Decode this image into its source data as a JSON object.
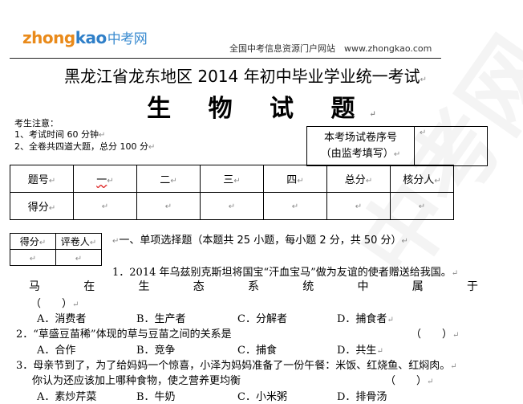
{
  "header": {
    "logo_zhong": "zhong",
    "logo_kao": "kao",
    "logo_cn": "中考网",
    "tagline": "全国中考信息资源门户网站　www.zhongkao.com",
    "watermark": "中考网"
  },
  "exam": {
    "title": "黑龙江省龙东地区 2014 年初中毕业学业统一考试",
    "subject": "生 物 试 题"
  },
  "notes": {
    "heading": "考生注意：",
    "items": [
      "1、考试时间 60 分钟",
      "2、全卷共四道大题，总分 100 分"
    ]
  },
  "seat_box": {
    "line1": "本考场试卷序号",
    "line2": "（由监考填写）"
  },
  "score_table": {
    "header": [
      "题号",
      "一",
      "二",
      "三",
      "四",
      "总分",
      "核分人"
    ],
    "row_label": "得分"
  },
  "grader_box": {
    "score": "得分",
    "grader": "评卷人"
  },
  "section1": "一、单项选择题（本题共 25 小题，每小题 2 分，共 50 分）",
  "questions": [
    {
      "stem_line1": "1．2014 年乌兹别克斯坦将国宝“汗血宝马”做为友谊的使者赠送给我国。",
      "stem_spread": [
        "马",
        "在",
        "生",
        "态",
        "系",
        "统",
        "中",
        "属",
        "于"
      ],
      "paren": "（　　）",
      "options": [
        "A．消费者",
        "B．生产者",
        "C．分解者",
        "D．捕食者"
      ]
    },
    {
      "stem_line1": "2．“草盛豆苗稀”体现的草与豆苗之间的关系是",
      "paren": "（　　）",
      "options": [
        "A．合作",
        "B．竞争",
        "C．捕食",
        "D．共生"
      ]
    },
    {
      "stem_line1": "3．母亲节到了，为了给妈妈一个惊喜，小泽为妈妈准备了一份午餐：米饭、红烧鱼、红焖肉。",
      "stem_line2": "你认为还应该加上哪种食物，使之营养更均衡",
      "paren": "（　　）",
      "options": [
        "A．素炒芹菜",
        "B．牛奶",
        "C．小米粥",
        "D．排骨汤"
      ]
    }
  ]
}
